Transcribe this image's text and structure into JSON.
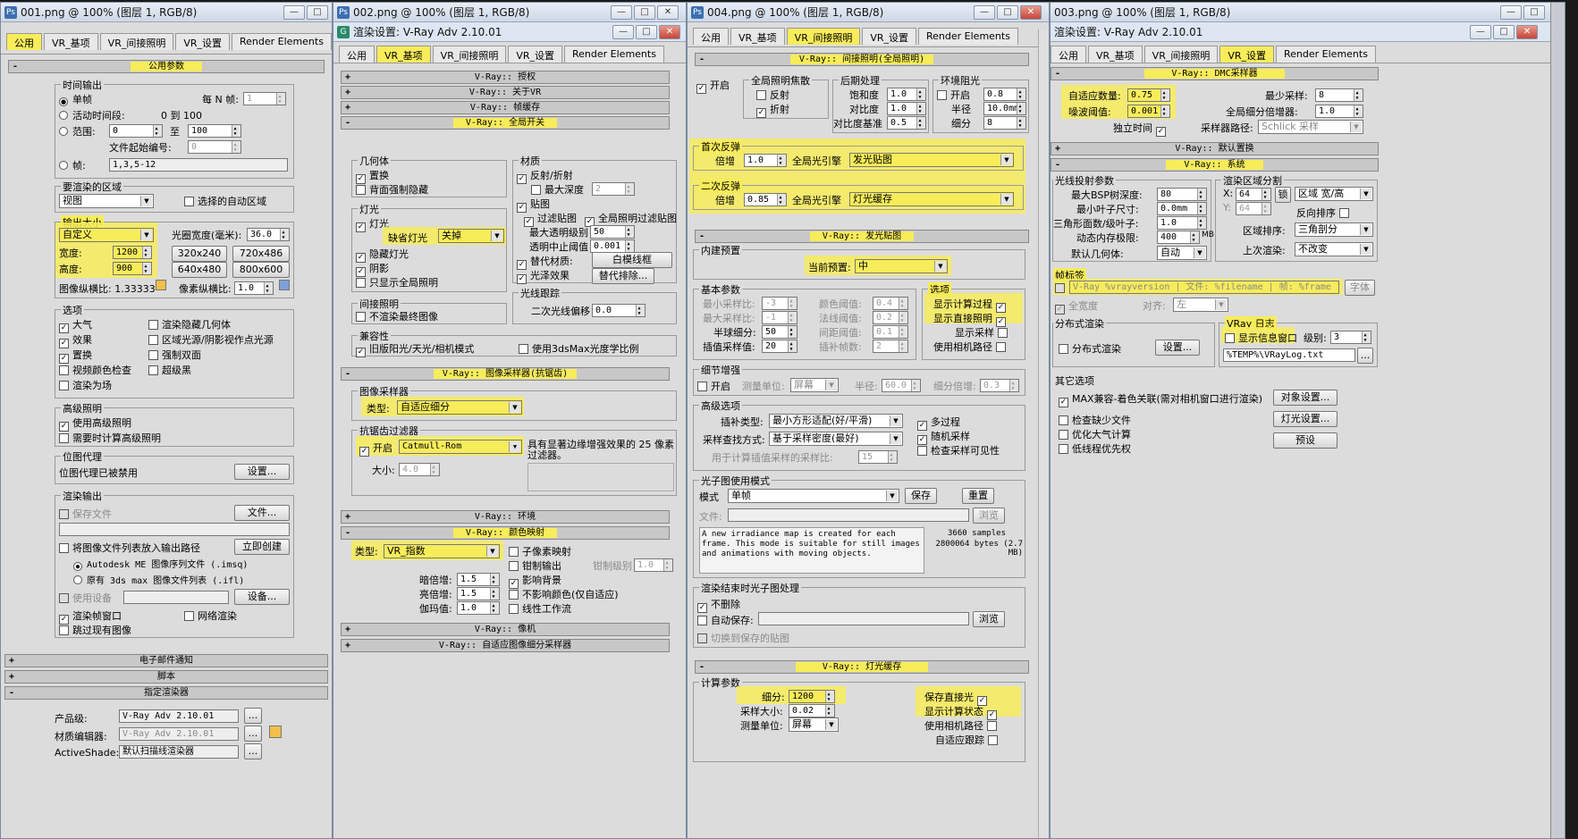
{
  "w1": {
    "title": "001.png @ 100% (图层 1, RGB/8)",
    "tabs": [
      "公用",
      "VR_基项",
      "VR_间接照明",
      "VR_设置",
      "Render Elements"
    ],
    "section": "公用参数",
    "time_out": "时间输出",
    "single": "单帧",
    "every_n": "每 N 帧:",
    "every_n_v": "1",
    "active": "活动时间段:",
    "active_v": "0 到 100",
    "range": "范围:",
    "range_from": "0",
    "range_to_lbl": "至",
    "range_to": "100",
    "file_start": "文件起始编号:",
    "file_start_v": "0",
    "frames": "帧:",
    "frames_v": "1,3,5-12",
    "area": "要渲染的区域",
    "area_v": "视图",
    "auto_region": "选择的自动区域",
    "out_size": "输出大小",
    "custom": "自定义",
    "aperture": "光圈宽度(毫米):",
    "aperture_v": "36.0",
    "width": "宽度:",
    "width_v": "1200",
    "height": "高度:",
    "height_v": "900",
    "p1": "320x240",
    "p2": "720x486",
    "p3": "640x480",
    "p4": "800x600",
    "aspect": "图像纵横比: 1.33333",
    "pix_aspect": "像素纵横比:",
    "pix_aspect_v": "1.0",
    "options": "选项",
    "o1": "大气",
    "o2": "效果",
    "o3": "置换",
    "o4": "视频颜色检查",
    "o5": "渲染为场",
    "o6": "渲染隐藏几何体",
    "o7": "区域光源/阴影视作点光源",
    "o8": "强制双面",
    "o9": "超级黑",
    "adv_light": "高级照明",
    "al1": "使用高级照明",
    "al2": "需要时计算高级照明",
    "bitmap_proxy": "位图代理",
    "bp_text": "位图代理已被禁用",
    "bp_btn": "设置...",
    "render_out": "渲染输出",
    "save_file": "保存文件",
    "files_btn": "文件...",
    "put_list": "将图像文件列表放入输出路径",
    "create_now": "立即创建",
    "autodesk": "Autodesk ME 图像序列文件 (.imsq)",
    "legacy": "原有 3ds max 图像文件列表 (.ifl)",
    "use_device": "使用设备",
    "device_btn": "设备...",
    "vfb": "渲染帧窗口",
    "net_render": "网络渲染",
    "skip_exist": "跳过现有图像",
    "email": "电子邮件通知",
    "script": "脚本",
    "assign": "指定渲染器",
    "production": "产品级:",
    "production_v": "V-Ray Adv 2.10.01",
    "mat_editor": "材质编辑器:",
    "mat_editor_v": "V-Ray Adv 2.10.01",
    "activeshade": "ActiveShade:",
    "activeshade_v": "默认扫描线渲染器",
    "dots": "..."
  },
  "w2": {
    "title": "002.png @ 100% (图层 1, RGB/8)",
    "dlg": "渲染设置: V-Ray Adv 2.10.01",
    "tabs": [
      "公用",
      "VR_基项",
      "VR_间接照明",
      "VR_设置",
      "Render Elements"
    ],
    "r_auth": "V-Ray:: 授权",
    "r_about": "V-Ray:: 关于VR",
    "r_fb": "V-Ray:: 帧缓存",
    "r_global": "V-Ray:: 全局开关",
    "geom": "几何体",
    "g1": "置换",
    "g2": "背面强制隐藏",
    "lights": "灯光",
    "l1": "灯光",
    "default_light": "缺省灯光",
    "default_light_v": "关掉",
    "l2": "隐藏灯光",
    "l3": "阴影",
    "l4": "只显示全局照明",
    "indirect": "间接照明",
    "i1": "不渲染最终图像",
    "compat": "兼容性",
    "c1": "旧版阳光/天光/相机模式",
    "c2": "使用3dsMax光度学比例",
    "mat": "材质",
    "m1": "反射/折射",
    "m2": "最大深度",
    "m2_v": "2",
    "m3": "贴图",
    "m4": "过滤贴图",
    "m5": "全局照明过滤贴图",
    "m6": "最大透明级别",
    "m6_v": "50",
    "m7": "透明中止阈值",
    "m7_v": "0.001",
    "m8": "替代材质:",
    "m8_btn": "白模线框",
    "m9": "光泽效果",
    "m9_btn": "替代排除...",
    "ray": "光线跟踪",
    "ray_bias": "二次光线偏移",
    "ray_bias_v": "0.0",
    "r_sampler": "V-Ray:: 图像采样器(抗锯齿)",
    "img_sampler": "图像采样器",
    "type": "类型:",
    "type_v": "自适应细分",
    "aa_filter": "抗锯齿过滤器",
    "on": "开启",
    "filter_v": "Catmull-Rom",
    "filter_desc": "具有显著边缘增强效果的 25 像素过滤器。",
    "size": "大小:",
    "size_v": "4.0",
    "r_env": "V-Ray:: 环境",
    "r_color": "V-Ray:: 颜色映射",
    "cm_type": "类型:",
    "cm_type_v": "VR_指数",
    "sub_pix": "子像素映射",
    "clamp": "钳制输出",
    "clamp_lvl": "钳制级别",
    "clamp_lvl_v": "1.0",
    "dark": "暗倍增:",
    "dark_v": "1.5",
    "bright": "亮倍增:",
    "bright_v": "1.5",
    "gamma": "伽玛值:",
    "gamma_v": "1.0",
    "affect_bg": "影响背景",
    "no_affect": "不影响颜色(仅自适应)",
    "linear": "线性工作流",
    "r_camera": "V-Ray:: 像机",
    "r_dmc_img": "V-Ray:: 自适应图像细分采样器"
  },
  "w3": {
    "title": "004.png @ 100% (图层 1, RGB/8)",
    "tabs": [
      "公用",
      "VR_基项",
      "VR_间接照明",
      "VR_设置",
      "Render Elements"
    ],
    "r_gi": "V-Ray:: 间接照明(全局照明)",
    "on": "开启",
    "caustics": "全局照明焦散",
    "reflect": "反射",
    "refract": "折射",
    "post": "后期处理",
    "sat": "饱和度",
    "sat_v": "1.0",
    "contrast": "对比度",
    "contrast_v": "1.0",
    "cbase": "对比度基准",
    "cbase_v": "0.5",
    "ao": "环境阻光",
    "ao_on": "开启",
    "ao_v": "0.8",
    "radius": "半径",
    "radius_v": "10.0mm",
    "subdiv": "细分",
    "subdiv_v": "8",
    "primary": "首次反弹",
    "mult": "倍增",
    "mult1_v": "1.0",
    "engine": "全局光引擎",
    "engine1_v": "发光贴图",
    "secondary": "二次反弹",
    "mult2_v": "0.85",
    "engine2_v": "灯光缓存",
    "r_irr": "V-Ray:: 发光贴图",
    "preset_grp": "内建预置",
    "preset": "当前预置:",
    "preset_v": "中",
    "basic": "基本参数",
    "minr": "最小采样比:",
    "minr_v": "-3",
    "maxr": "最大采样比:",
    "maxr_v": "-1",
    "hsph": "半球细分:",
    "hsph_v": "50",
    "interp": "插值采样值:",
    "interp_v": "20",
    "clr": "颜色阈值:",
    "clr_v": "0.4",
    "nrm": "法线阈值:",
    "nrm_v": "0.2",
    "dist": "间距阈值:",
    "dist_v": "0.1",
    "frm": "插补帧数:",
    "frm_v": "2",
    "opts": "选项",
    "show_calc": "显示计算过程",
    "show_direct": "显示直接照明",
    "show_samples": "显示采样",
    "use_cam": "使用相机路径",
    "detail": "细节增强",
    "d_on": "开启",
    "scale": "测量单位:",
    "scale_v": "屏幕",
    "d_radius": "半径:",
    "d_radius_v": "60.0",
    "d_mult": "细分倍增:",
    "d_mult_v": "0.3",
    "adv": "高级选项",
    "interp_type": "插补类型:",
    "interp_type_v": "最小方形适配(好/平滑)",
    "lookup": "采样查找方式:",
    "lookup_v": "基于采样密度(最好)",
    "calc_samples": "用于计算插值采样的采样比:",
    "calc_samples_v": "15",
    "multipass": "多过程",
    "rnd": "随机采样",
    "check_vis": "检查采样可见性",
    "mode_grp": "光子图使用模式",
    "mode": "模式",
    "mode_v": "单帧",
    "save": "保存",
    "reset": "重置",
    "file": "文件:",
    "browse": "浏览",
    "desc": "A new irradiance map is created for each frame. This mode is suitable for still images and animations with moving objects.",
    "samples": "3660 samples",
    "bytes": "2800064 bytes (2.7 MB)",
    "after": "渲染结束时光子图处理",
    "no_del": "不删除",
    "autosave": "自动保存:",
    "switch": "切换到保存的贴图",
    "r_lc": "V-Ray:: 灯光缓存",
    "calc": "计算参数",
    "lc_sub": "细分:",
    "lc_sub_v": "1200",
    "lc_size": "采样大小:",
    "lc_size_v": "0.02",
    "lc_scale": "测量单位:",
    "lc_scale_v": "屏幕",
    "store": "保存直接光",
    "show_phase": "显示计算状态",
    "lc_cam": "使用相机路径",
    "lc_adapt": "自适应跟踪"
  },
  "w4": {
    "title": "003.png @ 100% (图层 1, RGB/8)",
    "dlg": "渲染设置: V-Ray Adv 2.10.01",
    "tabs": [
      "公用",
      "VR_基项",
      "VR_间接照明",
      "VR_设置",
      "Render Elements"
    ],
    "r_dmc": "V-Ray:: DMC采样器",
    "adapt": "自适应数量:",
    "adapt_v": "0.75",
    "noise": "噪波阈值:",
    "noise_v": "0.001",
    "indep": "独立时间",
    "minsam": "最少采样:",
    "minsam_v": "8",
    "globsub": "全局细分倍增器:",
    "globsub_v": "1.0",
    "path": "采样器路径:",
    "path_v": "Schlick 采样",
    "r_disp": "V-Ray:: 默认置换",
    "r_sys": "V-Ray:: 系统",
    "raycast": "光线投射参数",
    "bsp": "最大BSP树深度:",
    "bsp_v": "80",
    "leaf": "最小叶子尺寸:",
    "leaf_v": "0.0mm",
    "face": "三角形面数/级叶子:",
    "face_v": "1.0",
    "mem": "动态内存极限:",
    "mem_v": "400",
    "mb": "MB",
    "geom": "默认几何体:",
    "geom_v": "自动",
    "region": "渲染区域分割",
    "x": "X:",
    "x_v": "64",
    "y": "Y:",
    "y_v": "64",
    "lock": "锁",
    "reg_type": "区域 宽/高",
    "rev": "反向排序",
    "seq": "区域排序:",
    "seq_v": "三角剖分",
    "prev": "上次渲染:",
    "prev_v": "不改变",
    "stamp": "帧标签",
    "stamp_v": "V-Ray %vrayversion | 文件: %filename | 帧: %frame | 基面",
    "font": "字体",
    "full": "全宽度",
    "align": "对齐:",
    "align_v": "左",
    "dist": "分布式渲染",
    "dist_on": "分布式渲染",
    "dist_set": "设置...",
    "log": "VRay 日志",
    "show_win": "显示信息窗口",
    "level": "级别:",
    "level_v": "3",
    "log_file": "%TEMP%\\VRayLog.txt",
    "misc": "其它选项",
    "max_compat": "MAX兼容-着色关联(需对相机窗口进行渲染)",
    "obj_set": "对象设置...",
    "check_miss": "检查缺少文件",
    "light_set": "灯光设置...",
    "opt_atm": "优化大气计算",
    "presets": "预设",
    "low_thread": "低线程优先权"
  }
}
